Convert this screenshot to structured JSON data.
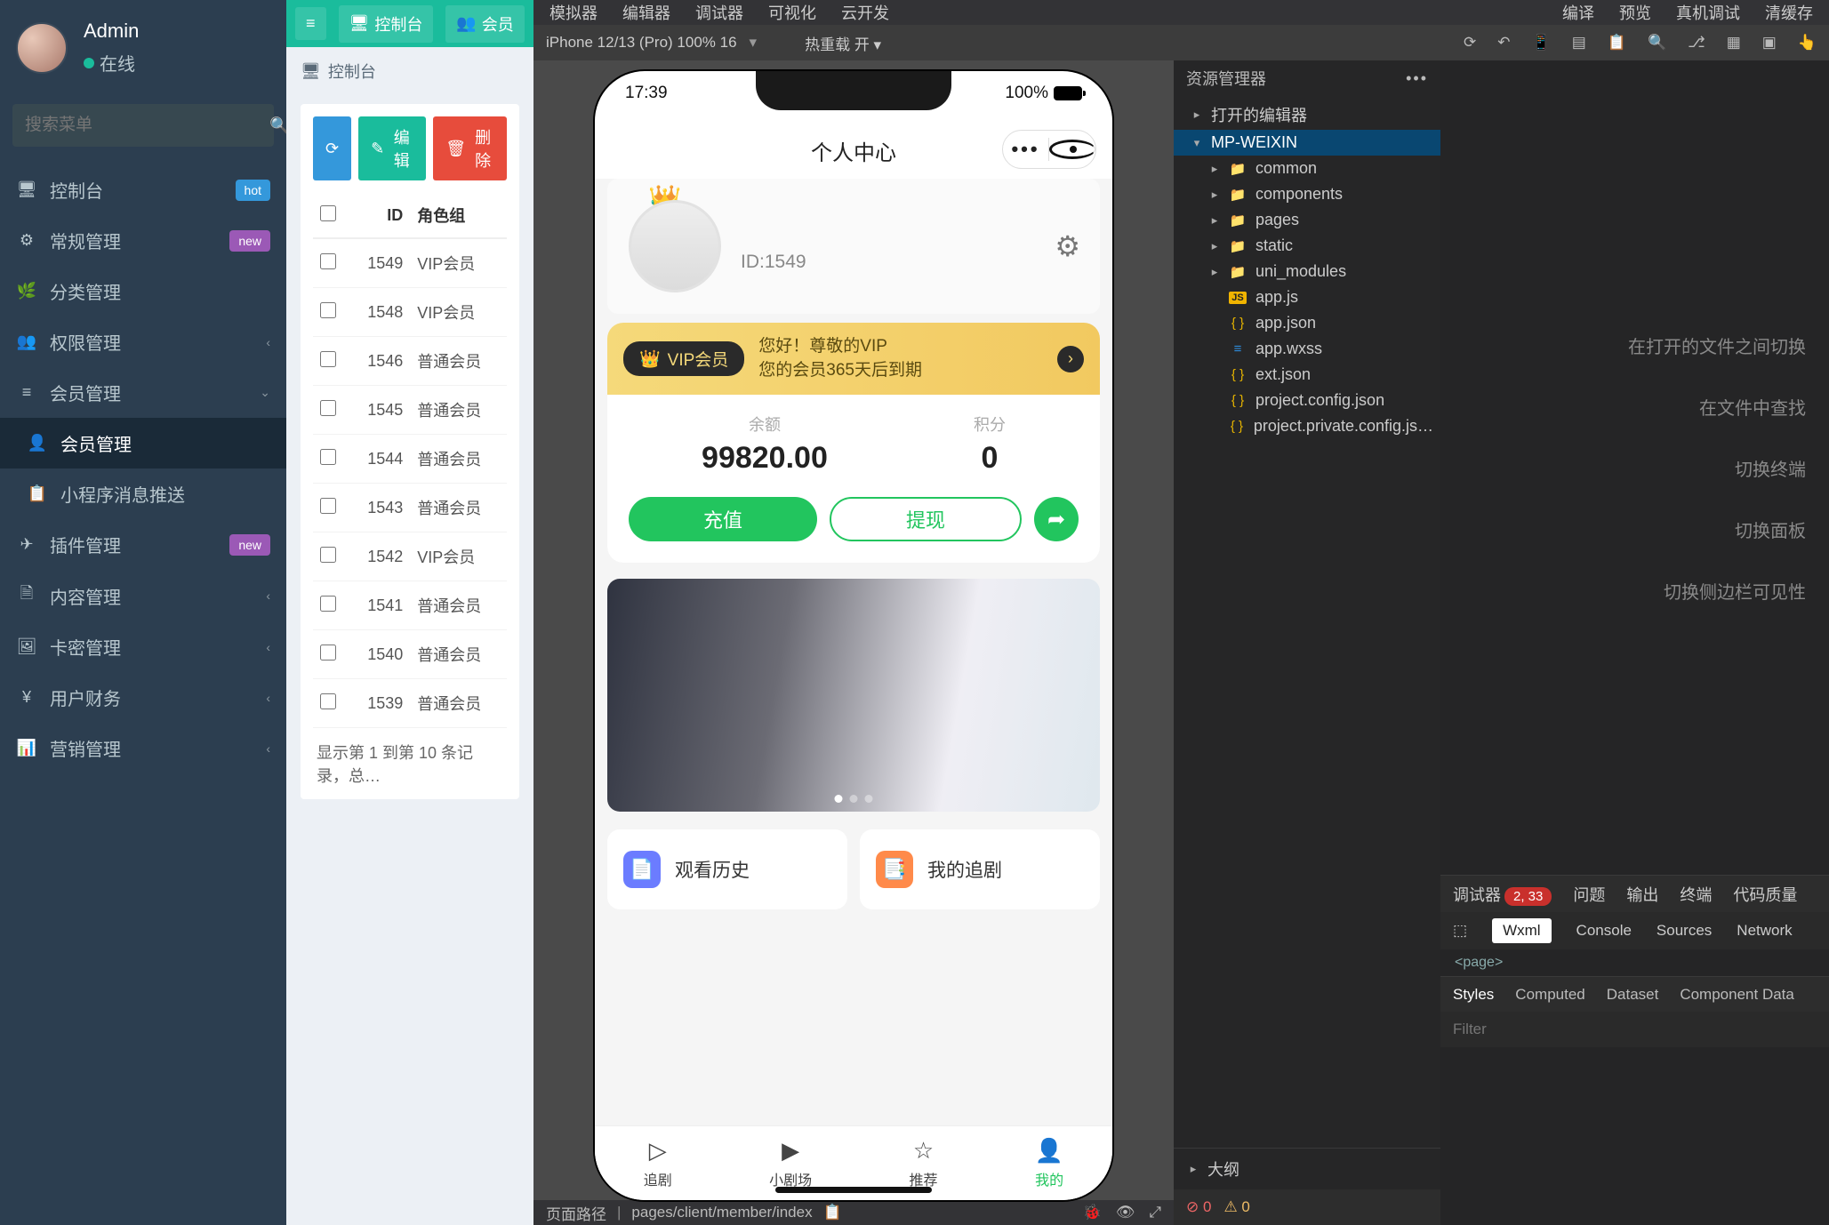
{
  "admin": {
    "profile": {
      "name": "Admin",
      "status": "在线"
    },
    "search_placeholder": "搜索菜单",
    "top_tabs": {
      "dashboard": "控制台",
      "member": "会员"
    },
    "breadcrumb": "控制台",
    "toolbar": {
      "edit": "编辑",
      "delete": "删除"
    },
    "table": {
      "headers": {
        "id": "ID",
        "role": "角色组"
      },
      "rows": [
        {
          "id": "1549",
          "role": "VIP会员"
        },
        {
          "id": "1548",
          "role": "VIP会员"
        },
        {
          "id": "1546",
          "role": "普通会员"
        },
        {
          "id": "1545",
          "role": "普通会员"
        },
        {
          "id": "1544",
          "role": "普通会员"
        },
        {
          "id": "1543",
          "role": "普通会员"
        },
        {
          "id": "1542",
          "role": "VIP会员"
        },
        {
          "id": "1541",
          "role": "普通会员"
        },
        {
          "id": "1540",
          "role": "普通会员"
        },
        {
          "id": "1539",
          "role": "普通会员"
        }
      ],
      "footer": "显示第 1 到第 10 条记录，总…"
    },
    "menu": [
      {
        "icon": "🖥",
        "label": "控制台",
        "badge": "hot",
        "b_text": "hot"
      },
      {
        "icon": "⚙",
        "label": "常规管理",
        "badge": "new",
        "b_text": "new"
      },
      {
        "icon": "🌿",
        "label": "分类管理"
      },
      {
        "icon": "👥",
        "label": "权限管理",
        "expand": true
      },
      {
        "icon": "≡",
        "label": "会员管理",
        "expand": true,
        "open": true
      },
      {
        "icon": "👤",
        "label": "会员管理",
        "sub": true,
        "active": true
      },
      {
        "icon": "📋",
        "label": "小程序消息推送",
        "sub": true
      },
      {
        "icon": "✈",
        "label": "插件管理",
        "badge": "new",
        "b_text": "new",
        "expand": true
      },
      {
        "icon": "🗎",
        "label": "内容管理",
        "expand": true
      },
      {
        "icon": "🖼",
        "label": "卡密管理",
        "expand": true
      },
      {
        "icon": "¥",
        "label": "用户财务",
        "expand": true
      },
      {
        "icon": "📊",
        "label": "营销管理",
        "expand": true
      }
    ]
  },
  "devtools": {
    "top_menu": {
      "l": [
        "模拟器",
        "编辑器",
        "调试器",
        "可视化",
        "云开发"
      ],
      "r": [
        "编译",
        "预览",
        "真机调试",
        "清缓存"
      ]
    },
    "device": "iPhone 12/13 (Pro) 100% 16",
    "reload": "热重载 开",
    "path_label": "页面路径",
    "path": "pages/client/member/index"
  },
  "phone": {
    "time": "17:39",
    "battery": "100%",
    "title": "个人中心",
    "user_id": "ID:1549",
    "vip_chip": "VIP会员",
    "vip_hello": "您好！尊敬的VIP",
    "vip_expire": "您的会员365天后到期",
    "balance_label": "余额",
    "balance": "99820.00",
    "points_label": "积分",
    "points": "0",
    "recharge": "充值",
    "withdraw": "提现",
    "tile1": "观看历史",
    "tile2": "我的追剧",
    "tabs": [
      {
        "icon": "▷",
        "label": "追剧"
      },
      {
        "icon": "▶",
        "label": "小剧场"
      },
      {
        "icon": "☆",
        "label": "推荐"
      },
      {
        "icon": "👤",
        "label": "我的",
        "active": true
      }
    ]
  },
  "ide": {
    "panel_title": "资源管理器",
    "open_editors": "打开的编辑器",
    "root": "MP-WEIXIN",
    "folders": [
      "common",
      "components",
      "pages",
      "static",
      "uni_modules"
    ],
    "files": [
      {
        "name": "app.js",
        "t": "js"
      },
      {
        "name": "app.json",
        "t": "json"
      },
      {
        "name": "app.wxss",
        "t": "wxss"
      },
      {
        "name": "ext.json",
        "t": "json"
      },
      {
        "name": "project.config.json",
        "t": "json"
      },
      {
        "name": "project.private.config.js…",
        "t": "json"
      }
    ],
    "outline": "大纲",
    "hints": [
      "在打开的文件之间切换",
      "在文件中查找",
      "切换终端",
      "切换面板",
      "切换侧边栏可见性"
    ]
  },
  "debug": {
    "tabs": {
      "debugger": "调试器",
      "badge": "2, 33",
      "issues": "问题",
      "output": "输出",
      "terminal": "终端",
      "quality": "代码质量"
    },
    "sub": {
      "wxml": "Wxml",
      "console": "Console",
      "sources": "Sources",
      "network": "Network"
    },
    "page": "<page>",
    "styles_tabs": {
      "styles": "Styles",
      "computed": "Computed",
      "dataset": "Dataset",
      "comp": "Component Data"
    },
    "filter_placeholder": "Filter",
    "status": {
      "err": "0",
      "warn": "0"
    }
  }
}
